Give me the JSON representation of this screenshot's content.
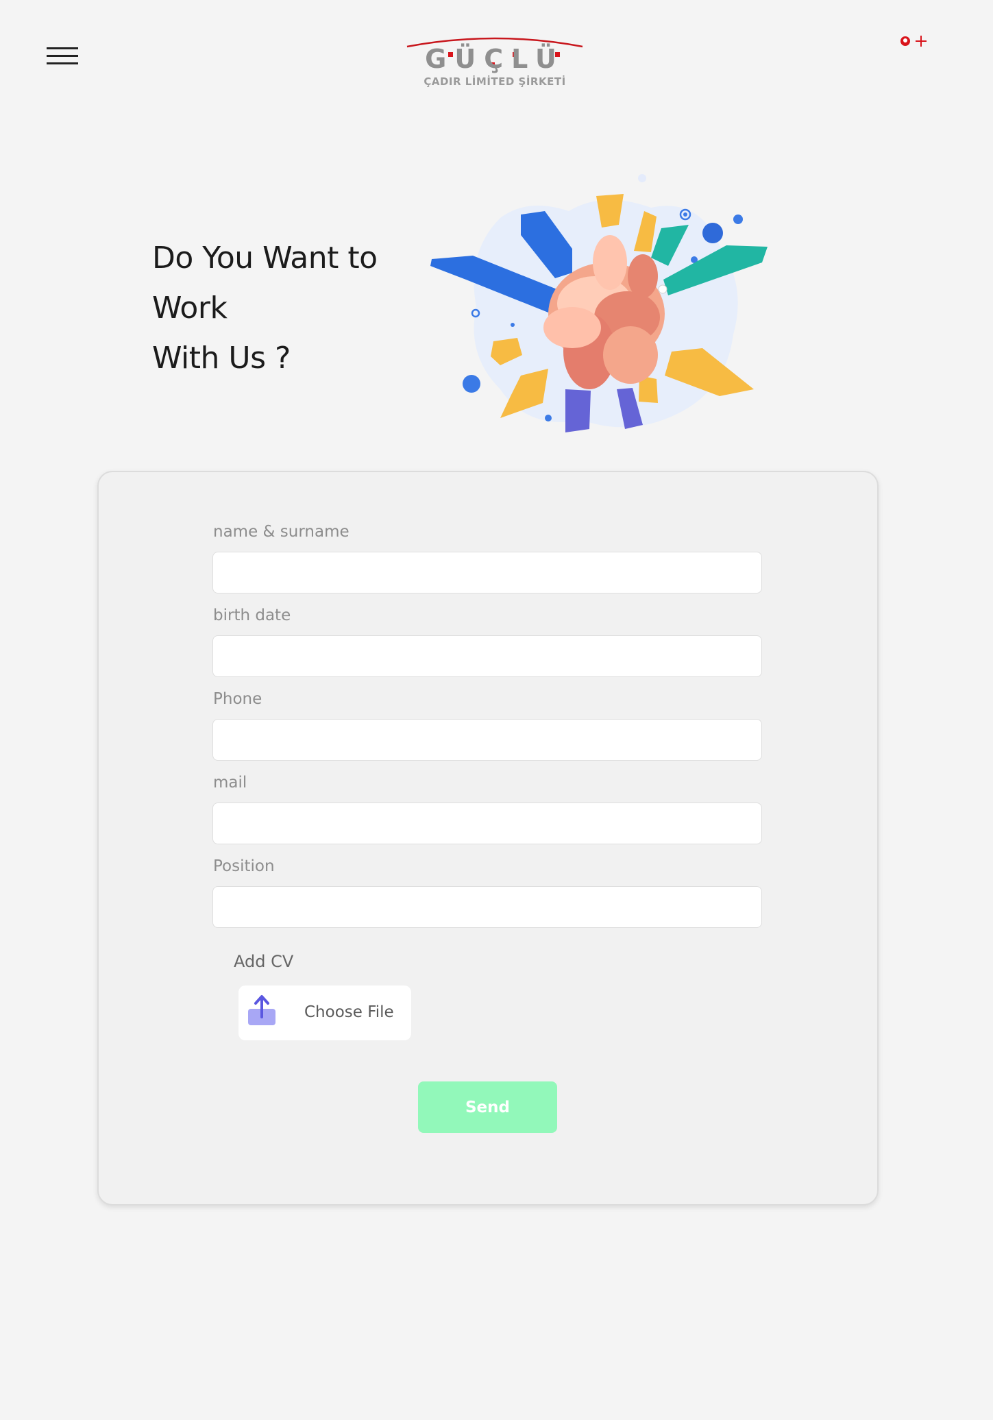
{
  "header": {
    "brand_name": "GÜÇLÜ",
    "brand_subtitle": "ÇADIR LİMİTED ŞİRKETİ",
    "accent_color": "#d9141b"
  },
  "hero": {
    "title_line1": "Do You Want to",
    "title_line2": "Work",
    "title_line3": "With Us ?"
  },
  "form": {
    "fields": [
      {
        "label": "name & surname",
        "value": ""
      },
      {
        "label": "birth date",
        "value": ""
      },
      {
        "label": "Phone",
        "value": ""
      },
      {
        "label": "mail",
        "value": ""
      },
      {
        "label": "Position",
        "value": ""
      }
    ],
    "cv_label": "Add CV",
    "file_button_label": "Choose File",
    "send_label": "Send",
    "send_color": "#92f8ba"
  },
  "icons": {
    "menu": "hamburger-menu-icon",
    "upload": "upload-icon",
    "lang_tr": "turkish-flag-icon",
    "lang_en": "english-flag-icon"
  }
}
